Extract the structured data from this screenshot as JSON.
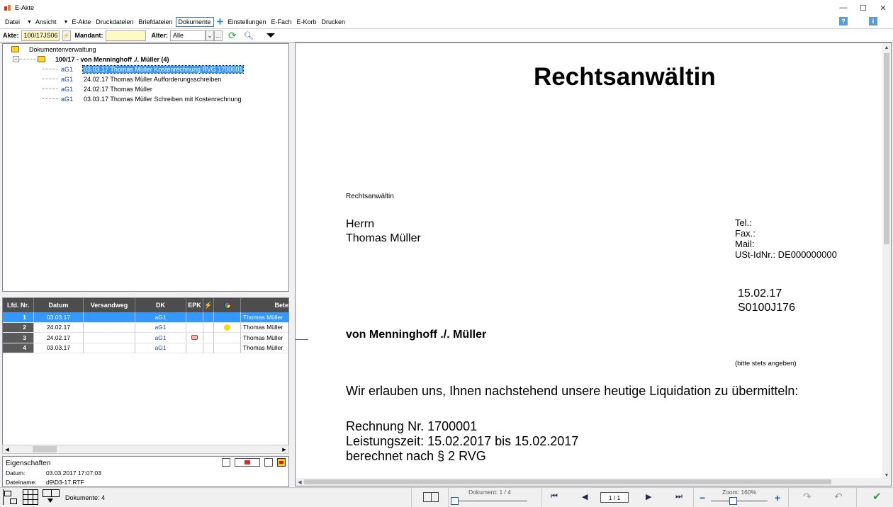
{
  "window": {
    "title": "E-Akte",
    "minimize": "—",
    "maximize": "☐",
    "close": "✕"
  },
  "menu": {
    "items": [
      {
        "label": "Datei"
      },
      {
        "label": "Ansicht"
      },
      {
        "label": "E-Akte"
      },
      {
        "label": "Druckdateien"
      },
      {
        "label": "Briefdateien"
      },
      {
        "label": "Dokumente"
      },
      {
        "label": "Einstellungen"
      },
      {
        "label": "E-Fach"
      },
      {
        "label": "E-Korb"
      },
      {
        "label": "Drucken"
      }
    ],
    "help_icon": "?",
    "info_icon": "i"
  },
  "akte_bar": {
    "akte_label": "Akte:",
    "akte_value": "100/17JS06",
    "mandant_label": "Mandant:",
    "mandant_value": "",
    "alter_label": "Alter:",
    "alter_value": "Alle",
    "more_label": "..."
  },
  "tree": {
    "root": "Dokumentenverwaltung",
    "case": "100/17 - von Menninghoff ./. Müller (4)",
    "docs": [
      {
        "code": "aG1",
        "label": "03.03.17 Thomas Müller Kostenrechnung RVG 1700001"
      },
      {
        "code": "aG1",
        "label": "24.02.17 Thomas Müller Aufforderungsschreiben"
      },
      {
        "code": "aG1",
        "label": "24.02.17 Thomas Müller"
      },
      {
        "code": "aG1",
        "label": "03.03.17 Thomas Müller Schreiben mit Kostenrechnung"
      }
    ]
  },
  "table": {
    "headers": [
      "Lfd. Nr.",
      "Datum",
      "Versandweg",
      "DK",
      "EPK",
      "⚡",
      "",
      "Bete"
    ],
    "rows": [
      {
        "nr": "1",
        "datum": "03.03.17",
        "versandweg": "",
        "dk": "aG1",
        "epk": "",
        "beteiligt": "Thomas Müller"
      },
      {
        "nr": "2",
        "datum": "24.02.17",
        "versandweg": "",
        "dk": "aG1",
        "epk": "",
        "beteiligt": "Thomas Müller"
      },
      {
        "nr": "3",
        "datum": "24.02.17",
        "versandweg": "",
        "dk": "aG1",
        "epk": "",
        "beteiligt": "Thomas Müller"
      },
      {
        "nr": "4",
        "datum": "03.03.17",
        "versandweg": "",
        "dk": "aG1",
        "epk": "",
        "beteiligt": "Thomas Müller"
      }
    ]
  },
  "properties": {
    "title": "Eigenschaften",
    "datum_label": "Datum:",
    "datum_value": "03.03.2017 17:07:03",
    "dateiname_label": "Dateiname:",
    "dateiname_value": "d9\\D3-17.RTF"
  },
  "status": {
    "doc_count": "Dokumente: 4",
    "document_label": "Dokument: 1 / 4",
    "page_value": "1 / 1",
    "zoom_label": "Zoom: 160%"
  },
  "document": {
    "heading": "Rechtsanwältin",
    "sender_line": "Rechtsanwältin",
    "recipient_1": "Herrn",
    "recipient_2": "Thomas Müller",
    "tel": "Tel.:",
    "fax": "Fax.:",
    "mail": "Mail:",
    "ustid": "USt-IdNr.: DE000000000",
    "date": "15.02.17",
    "ref": "S0100J176",
    "subject": "von Menninghoff ./. Müller",
    "note": "(bitte stets angeben)",
    "intro": "Wir erlauben uns, Ihnen nachstehend unsere heutige Liquidation zu übermitteln:",
    "invoice": "Rechnung Nr. 1700001",
    "period": "Leistungszeit: 15.02.2017 bis 15.02.2017",
    "basis": "berechnet nach § 2 RVG"
  }
}
